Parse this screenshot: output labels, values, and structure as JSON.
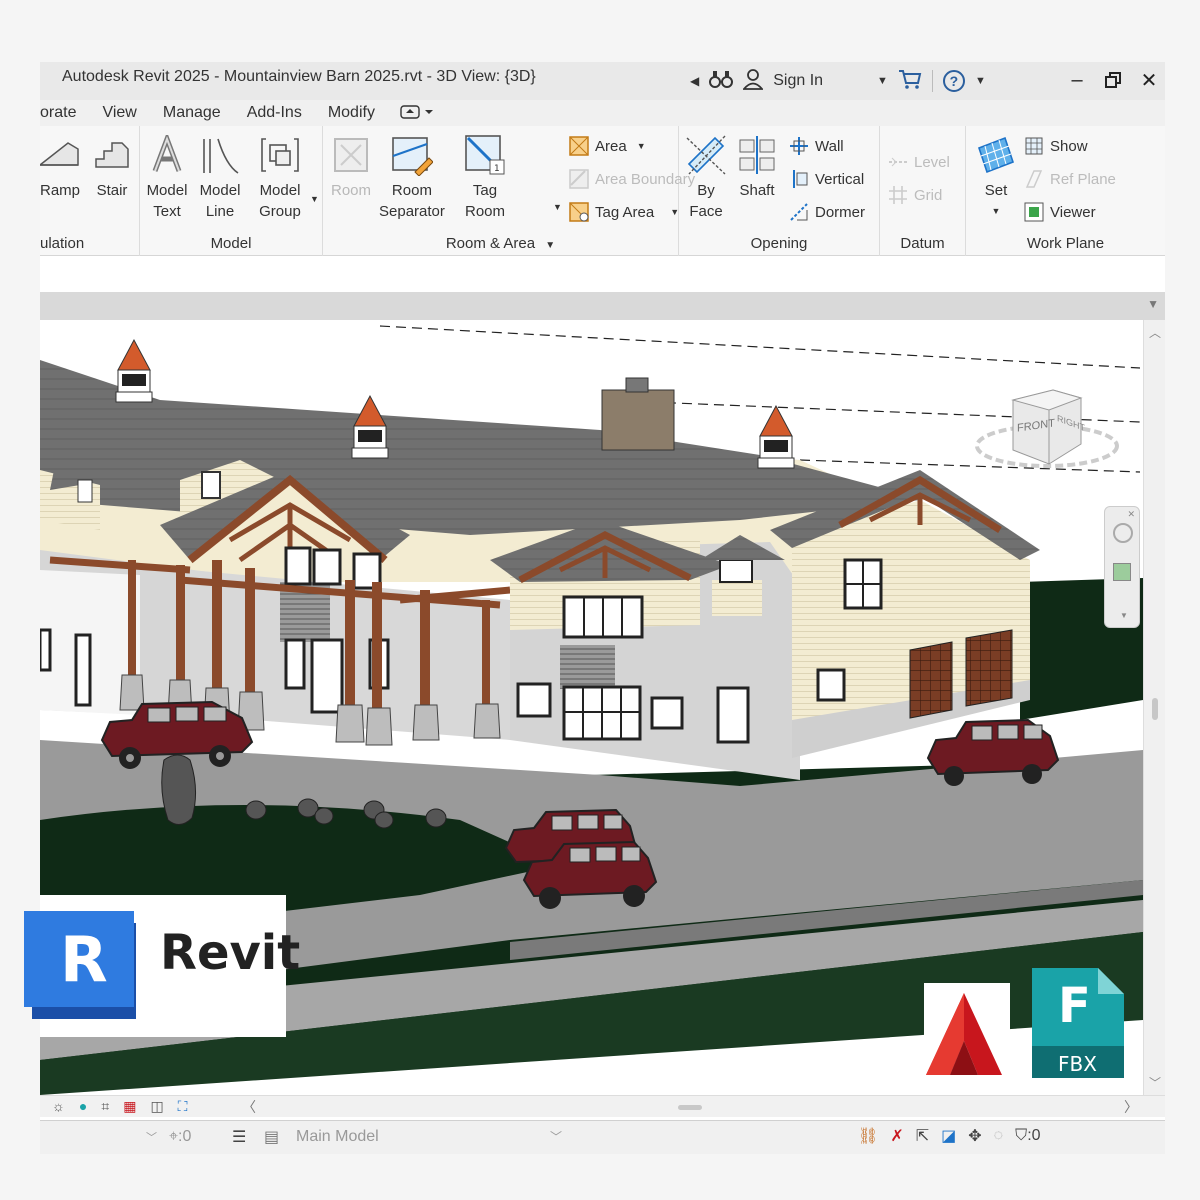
{
  "window": {
    "title": "Autodesk Revit 2025 - Mountainview Barn 2025.rvt - 3D View: {3D}",
    "sign_in": "Sign In",
    "help": "?"
  },
  "tabs": [
    "orate",
    "View",
    "Manage",
    "Add-Ins",
    "Modify"
  ],
  "ribbon": {
    "circulation": {
      "title": "ulation",
      "ramp": "Ramp",
      "stair": "Stair"
    },
    "model": {
      "title": "Model",
      "text": [
        "Model",
        "Text"
      ],
      "line": [
        "Model",
        "Line"
      ],
      "group": [
        "Model",
        "Group"
      ]
    },
    "room_area": {
      "title": "Room & Area",
      "room": "Room",
      "separator": [
        "Room",
        "Separator"
      ],
      "tag_room": [
        "Tag",
        "Room"
      ],
      "area": "Area",
      "area_boundary": "Area  Boundary",
      "tag_area": "Tag  Area"
    },
    "opening": {
      "title": "Opening",
      "by_face": [
        "By",
        "Face"
      ],
      "shaft": "Shaft",
      "wall": "Wall",
      "vertical": "Vertical",
      "dormer": "Dormer"
    },
    "datum": {
      "title": "Datum",
      "level": "Level",
      "grid": "Grid"
    },
    "work_plane": {
      "title": "Work Plane",
      "set": "Set",
      "show": "Show",
      "ref_plane": "Ref  Plane",
      "viewer": "Viewer"
    }
  },
  "viewcube": {
    "front": "FRONT",
    "right": "RIGHT"
  },
  "statusbar": {
    "selection_count": ":0",
    "model": "Main Model",
    "filter_count": ":0"
  },
  "logos": {
    "revit_letter": "R",
    "revit_word": "Revit",
    "fbx_letter": "F",
    "fbx_word": "FBX"
  },
  "colors": {
    "revit_blue": "#1f6fd1",
    "acad_red": "#c8161d",
    "fbx_teal": "#1aa3a8",
    "roof": "#6e6e6e",
    "siding": "#f3ecd2",
    "timber": "#8b4a2b",
    "car": "#6d1a22",
    "lawn": "#0f2a16"
  }
}
